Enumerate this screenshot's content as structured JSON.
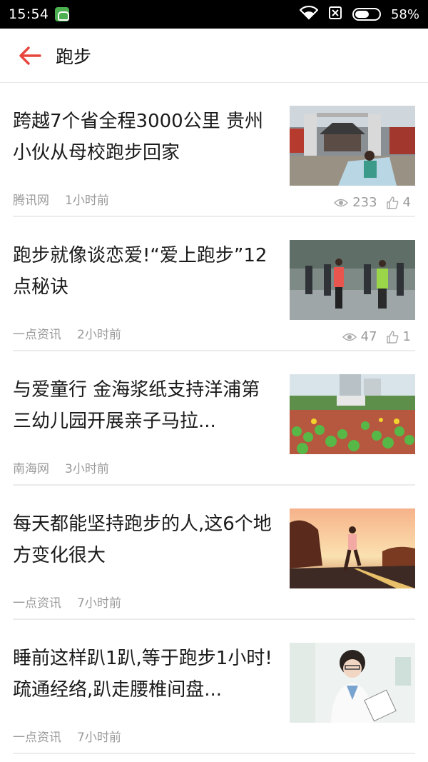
{
  "status_bar": {
    "time": "15:54",
    "battery_percent": "58%",
    "battery_level": 0.58
  },
  "header": {
    "title": "跑步",
    "accent_color": "#e8453c"
  },
  "articles": [
    {
      "title": "跨越7个省全程3000公里 贵州小伙从母校跑步回家",
      "source": "腾讯网",
      "time": "1小时前",
      "views": "233",
      "likes": "4",
      "image": "school-gate-runner-photo"
    },
    {
      "title": "跑步就像谈恋爱!“爱上跑步”12点秘诀",
      "source": "一点资讯",
      "time": "2小时前",
      "views": "47",
      "likes": "1",
      "image": "group-runners-photo"
    },
    {
      "title": "与爱童行 金海浆纸支持洋浦第三幼儿园开展亲子马拉...",
      "source": "南海网",
      "time": "3小时前",
      "image": "children-marathon-photo"
    },
    {
      "title": "每天都能坚持跑步的人,这6个地方变化很大",
      "source": "一点资讯",
      "time": "7小时前",
      "image": "sunset-runner-photo"
    },
    {
      "title": "睡前这样趴1趴,等于跑步1小时!疏通经络,趴走腰椎间盘...",
      "source": "一点资讯",
      "time": "7小时前",
      "image": "doctor-photo"
    }
  ]
}
